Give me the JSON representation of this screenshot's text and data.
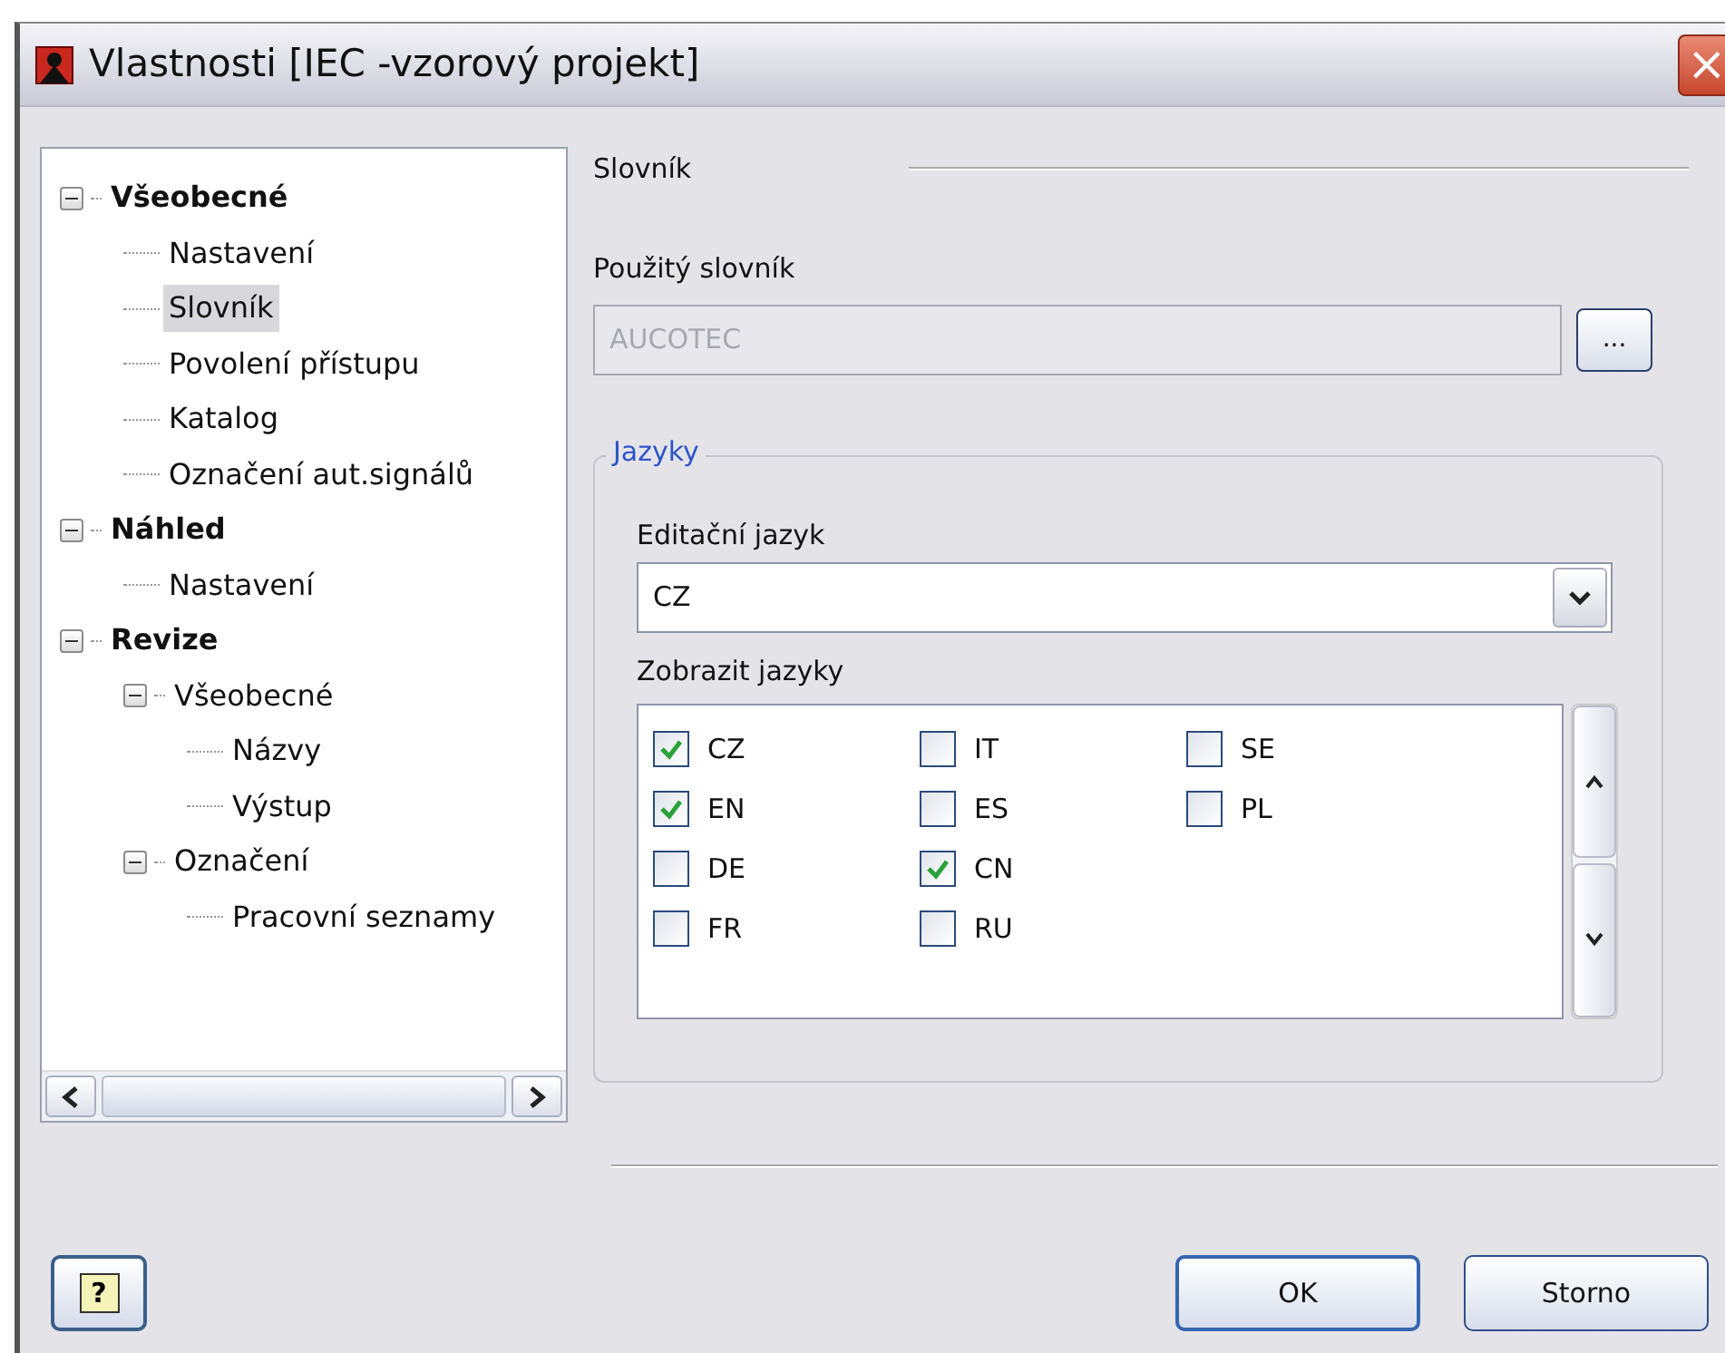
{
  "window": {
    "title": "Vlastnosti [IEC -vzorový projekt]",
    "close": "×"
  },
  "tree": [
    {
      "label": "Všeobecné",
      "bold": true,
      "expanded": true,
      "selected": false,
      "children": [
        {
          "label": "Nastavení",
          "selected": false
        },
        {
          "label": "Slovník",
          "selected": true
        },
        {
          "label": "Povolení přístupu",
          "selected": false
        },
        {
          "label": "Katalog",
          "selected": false
        },
        {
          "label": "Označení aut.signálů",
          "selected": false
        }
      ]
    },
    {
      "label": "Náhled",
      "bold": true,
      "expanded": true,
      "selected": false,
      "children": [
        {
          "label": "Nastavení",
          "selected": false
        }
      ]
    },
    {
      "label": "Revize",
      "bold": true,
      "expanded": true,
      "selected": false,
      "children": [
        {
          "label": "Všeobecné",
          "expanded": true,
          "selected": false,
          "children": [
            {
              "label": "Názvy",
              "selected": false
            },
            {
              "label": "Výstup",
              "selected": false
            }
          ]
        },
        {
          "label": "Označení",
          "expanded": true,
          "selected": false,
          "children": [
            {
              "label": "Pracovní seznamy",
              "selected": false
            }
          ]
        }
      ]
    }
  ],
  "page": {
    "heading": "Slovník",
    "dictionary_label": "Použitý slovník",
    "dictionary_value": "AUCOTEC",
    "dictionary_disabled": true,
    "browse_button": "...",
    "group": {
      "legend": "Jazyky",
      "edit_language_label": "Editační jazyk",
      "edit_language_value": "CZ",
      "show_languages_label": "Zobrazit jazyky",
      "languages": [
        {
          "label": "CZ",
          "checked": true
        },
        {
          "label": "EN",
          "checked": true
        },
        {
          "label": "DE",
          "checked": false
        },
        {
          "label": "FR",
          "checked": false
        },
        {
          "label": "IT",
          "checked": false
        },
        {
          "label": "ES",
          "checked": false
        },
        {
          "label": "CN",
          "checked": true
        },
        {
          "label": "RU",
          "checked": false
        },
        {
          "label": "SE",
          "checked": false
        },
        {
          "label": "PL",
          "checked": false
        }
      ]
    }
  },
  "buttons": {
    "help": "?",
    "ok": "OK",
    "cancel": "Storno"
  }
}
